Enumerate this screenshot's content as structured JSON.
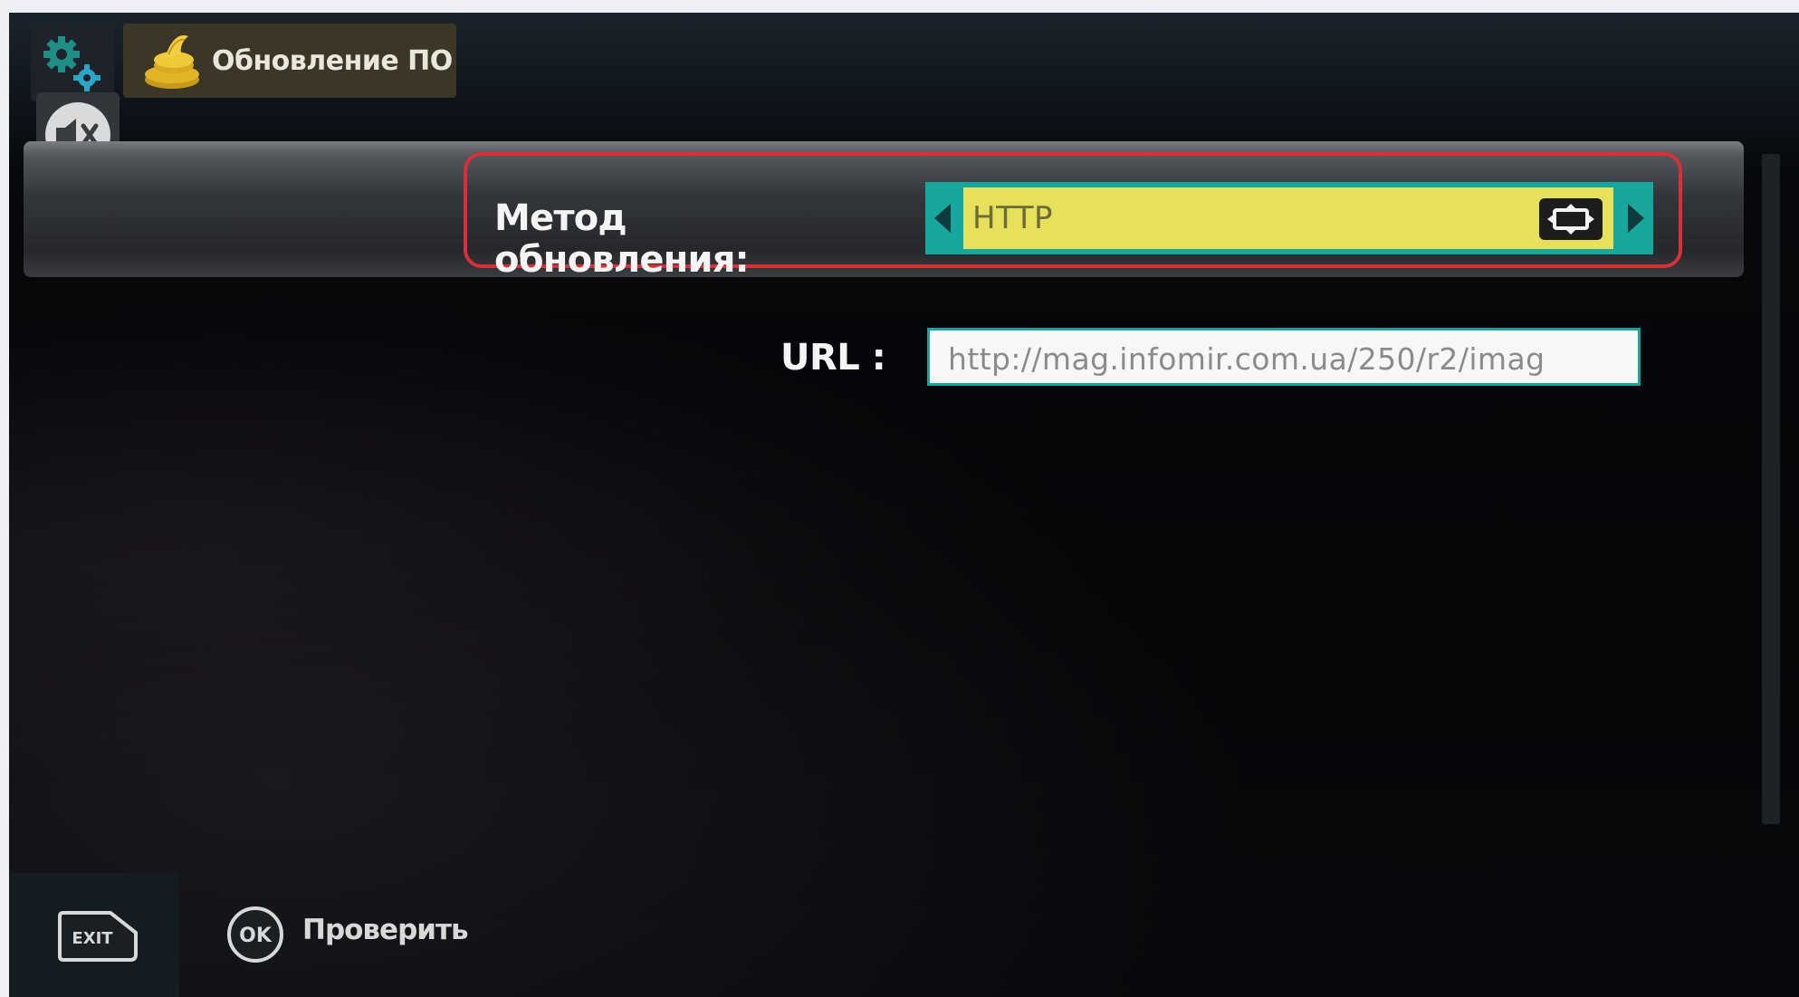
{
  "header": {
    "title": "Обновление ПО",
    "settings_icon": "gears-icon",
    "tab_icon": "update-stack-icon"
  },
  "mute": {
    "icon": "mute-speaker-icon"
  },
  "form": {
    "method": {
      "label": "Метод обновления:",
      "value": "HTTP",
      "prev_icon": "arrow-left-icon",
      "next_icon": "arrow-right-icon",
      "aspect_icon": "screen-aspect-icon"
    },
    "url": {
      "label": "URL :",
      "value": "http://mag.infomir.com.ua/250/r2/imag"
    }
  },
  "footer": {
    "exit_label": "EXIT",
    "ok_label": "OK",
    "check_label": "Проверить"
  },
  "colors": {
    "accent_teal": "#18a79d",
    "selected_yellow": "#e6e05a",
    "highlight_red": "#d6313a"
  }
}
